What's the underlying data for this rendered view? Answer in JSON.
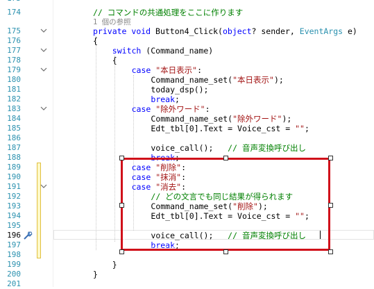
{
  "editor": {
    "lines": [
      {
        "no": "173",
        "text": ""
      },
      {
        "no": "174",
        "text": "// コマンドの共通処理をここに作ります"
      },
      {
        "no": "",
        "text": "1 個の参照"
      },
      {
        "no": "175",
        "text": "private void Button4_Click(object? sender, EventArgs e)"
      },
      {
        "no": "176",
        "text": "{"
      },
      {
        "no": "177",
        "text": "switch (Command_name)"
      },
      {
        "no": "178",
        "text": "{"
      },
      {
        "no": "179",
        "text": "case \"本日表示\":"
      },
      {
        "no": "180",
        "text": "Command_name_set(\"本日表示\");"
      },
      {
        "no": "181",
        "text": "today_dsp();"
      },
      {
        "no": "182",
        "text": "break;"
      },
      {
        "no": "183",
        "text": "case \"除外ワード\":"
      },
      {
        "no": "184",
        "text": "Command_name_set(\"除外ワード\");"
      },
      {
        "no": "185",
        "text": "Edt_tbl[0].Text = Voice_cst = \"\";"
      },
      {
        "no": "186",
        "text": ""
      },
      {
        "no": "187",
        "text": "voice_call();   // 音声変換呼び出し"
      },
      {
        "no": "188",
        "text": "break;"
      },
      {
        "no": "189",
        "text": "case \"削除\":"
      },
      {
        "no": "190",
        "text": "case \"抹消\":"
      },
      {
        "no": "191",
        "text": "case \"消去\":"
      },
      {
        "no": "192",
        "text": "// どの文言でも同じ結果が得られます"
      },
      {
        "no": "193",
        "text": "Command_name_set(\"削除\");"
      },
      {
        "no": "194",
        "text": "Edt_tbl[0].Text = Voice_cst = \"\";"
      },
      {
        "no": "195",
        "text": ""
      },
      {
        "no": "196",
        "text": "voice_call();   // 音声変換呼び出し"
      },
      {
        "no": "197",
        "text": "break;"
      },
      {
        "no": "198",
        "text": ""
      },
      {
        "no": "199",
        "text": "}"
      },
      {
        "no": "200",
        "text": "}"
      },
      {
        "no": "201",
        "text": ""
      }
    ],
    "current_line": "196",
    "colors": {
      "keyword": "#0000ff",
      "string": "#a31515",
      "comment": "#008000",
      "type": "#2b91af",
      "line_number": "#2b91af",
      "selection_border": "#d0101a"
    },
    "icons": [
      "collapse-icon",
      "quick-actions-icon"
    ]
  }
}
